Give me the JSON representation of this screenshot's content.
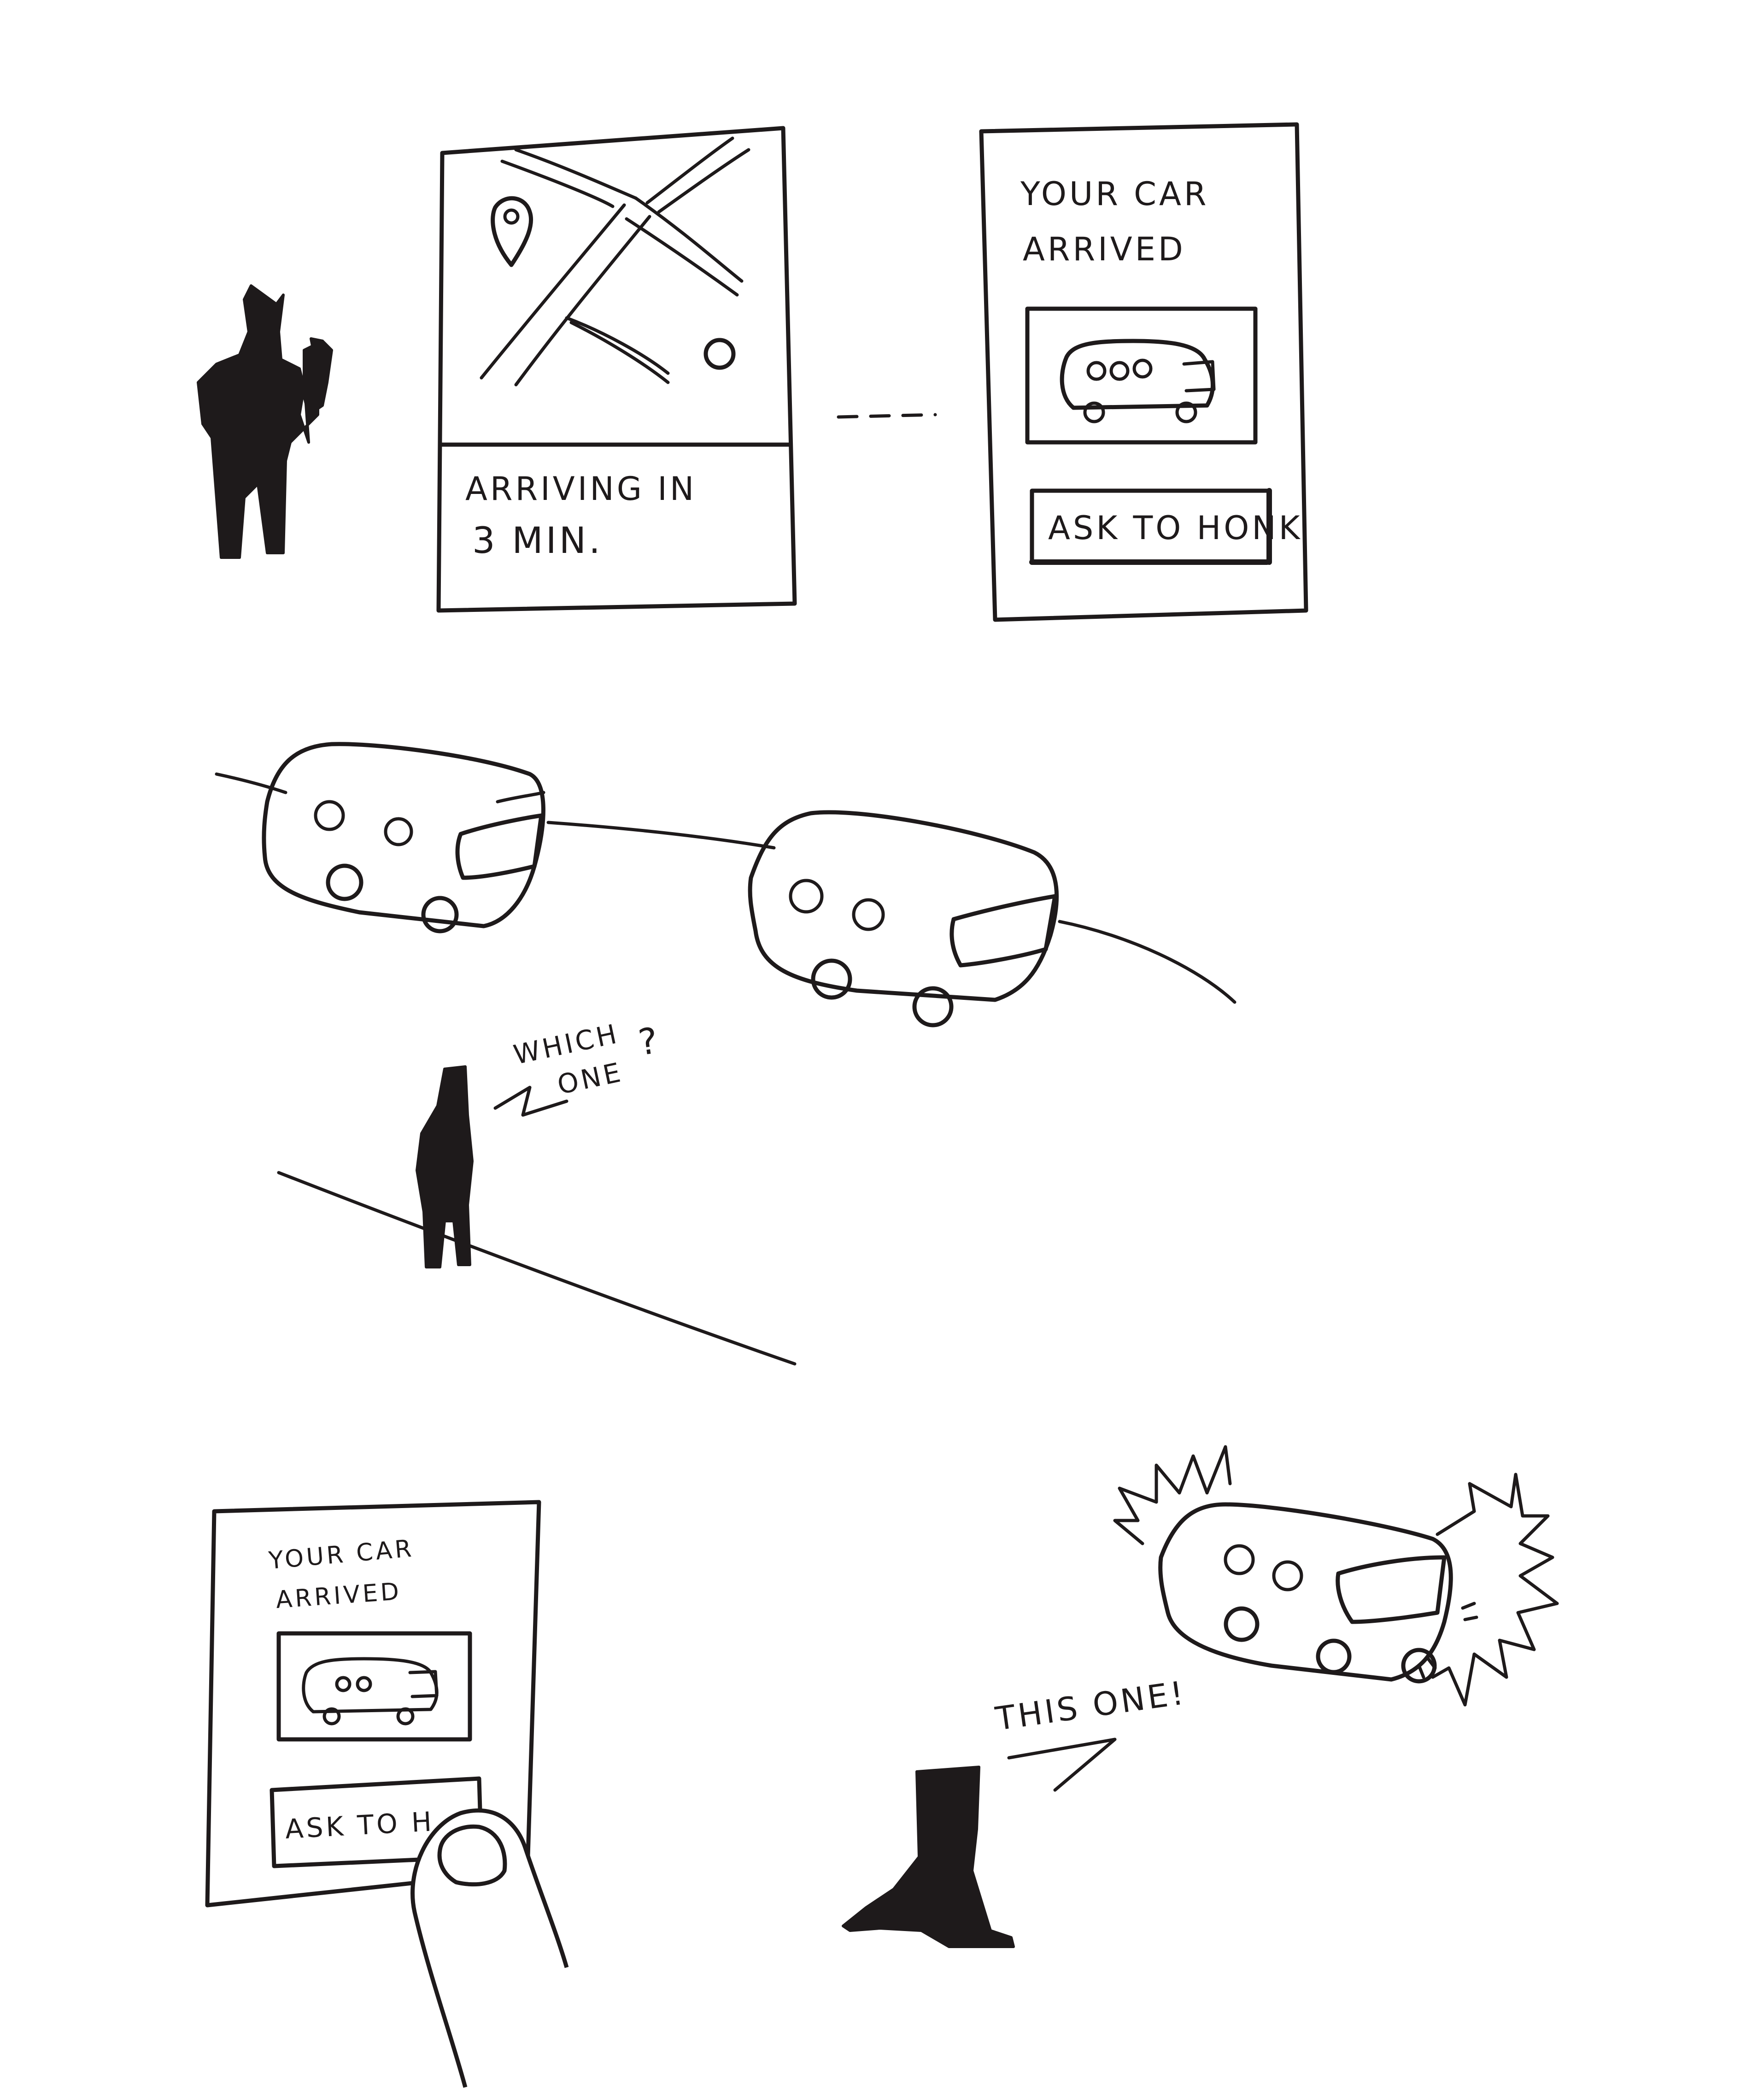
{
  "panel1": {
    "map_screen": {
      "status_line1": "ARRIVING IN",
      "status_line2": "3 MIN."
    },
    "arrived_screen": {
      "title_line1": "YOUR CAR",
      "title_line2": "ARRIVED",
      "honk_button": "ASK TO HONK"
    }
  },
  "panel2": {
    "speech": {
      "line1": "WHICH",
      "line2": "ONE",
      "mark": "?"
    }
  },
  "panel3": {
    "arrived_screen": {
      "title_line1": "YOUR CAR",
      "title_line2": "ARRIVED",
      "honk_button_partial": "ASK TO H"
    },
    "speech": "THIS ONE!"
  },
  "colors": {
    "ink": "#1e1a1b",
    "paper": "#ffffff"
  }
}
